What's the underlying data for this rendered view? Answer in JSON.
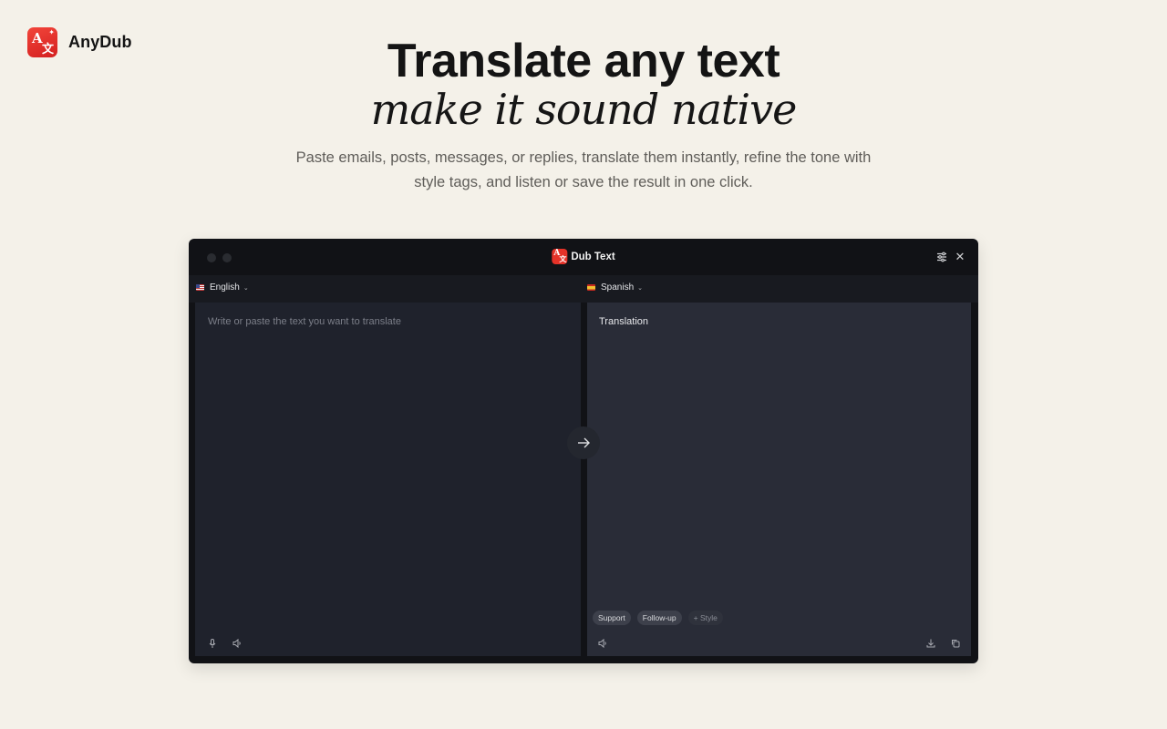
{
  "brand": {
    "name": "AnyDub"
  },
  "hero": {
    "headline": "Translate any text",
    "subheadline": "make it sound native",
    "description": "Paste emails, posts, messages, or replies, translate them instantly, refine the tone with style tags, and listen or save the result in one click."
  },
  "window": {
    "title": "Dub Text",
    "source_language": {
      "label": "English",
      "flag": "us-flag-icon"
    },
    "target_language": {
      "label": "Spanish",
      "flag": "es-flag-icon"
    },
    "source_placeholder": "Write or paste the text you want to translate",
    "translation_text": "Translation",
    "style_tags": [
      "Support",
      "Follow-up"
    ],
    "add_style_label": "+ Style",
    "icons": [
      "settings-sliders-icon",
      "close-icon",
      "translate-arrow-icon",
      "microphone-icon",
      "speaker-icon",
      "download-icon",
      "copy-icon"
    ]
  },
  "colors": {
    "background": "#f4f1e9",
    "window": "#111216",
    "accent": "#e53228"
  }
}
